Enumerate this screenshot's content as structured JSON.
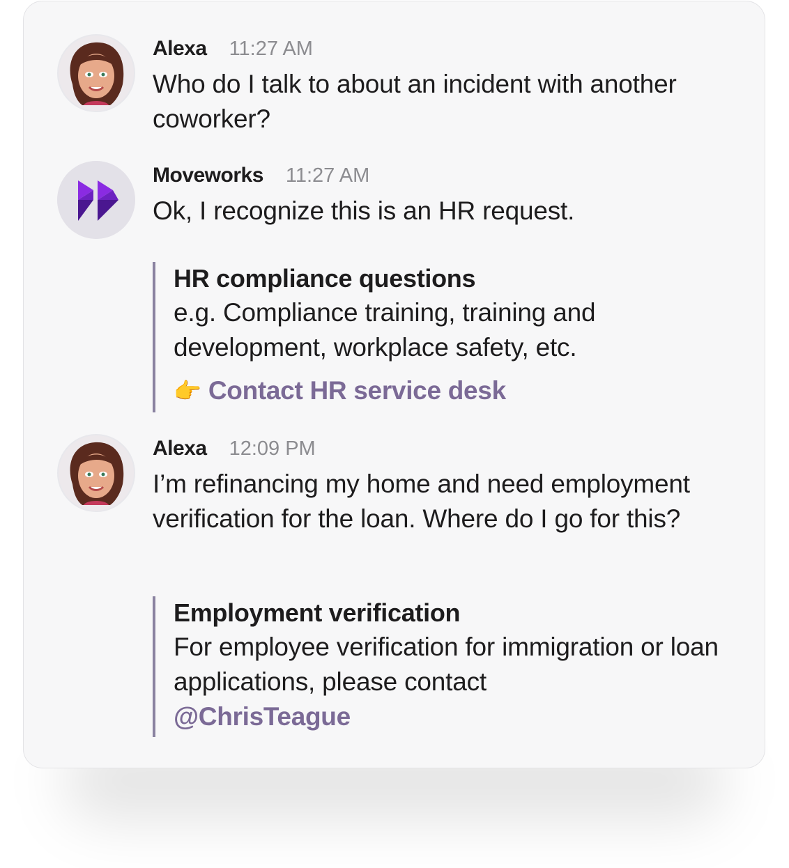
{
  "messages": [
    {
      "author": "Alexa",
      "time": "11:27 AM",
      "text": "Who do I talk to about an incident with another coworker?"
    },
    {
      "author": "Moveworks",
      "time": "11:27 AM",
      "text": "Ok, I recognize this is an HR request.",
      "attachment": {
        "title": "HR compliance questions",
        "description": "e.g. Compliance training, training and development, workplace safety, etc.",
        "action_icon": "pointing-hand-icon",
        "action_emoji": "👉",
        "action_label": "Contact HR service desk"
      }
    },
    {
      "author": "Alexa",
      "time": "12:09 PM",
      "text": "I’m refinancing my home and need employment verification for the loan. Where do I go for this?",
      "attachment": {
        "title": "Employment verification",
        "description": "For employee verification for immigration or loan applications, please contact",
        "mention": "@ChrisTeague"
      }
    }
  ],
  "colors": {
    "accent_link": "#7b6a96",
    "quote_bar": "#8a82a0",
    "bot_logo": "#5a1fb0",
    "card_bg": "#f7f7f8"
  }
}
